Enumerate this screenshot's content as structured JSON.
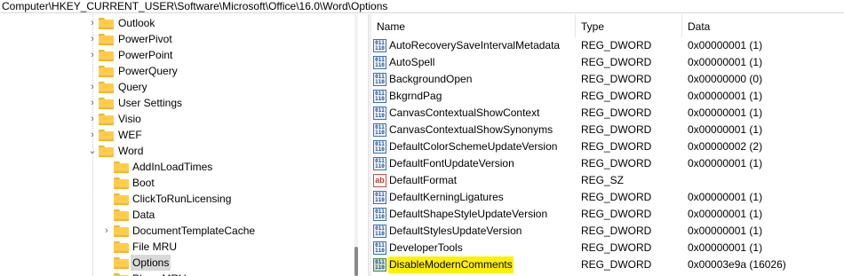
{
  "address": "Computer\\HKEY_CURRENT_USER\\Software\\Microsoft\\Office\\16.0\\Word\\Options",
  "tree": {
    "items": [
      {
        "label": "Outlook",
        "expander": "›"
      },
      {
        "label": "PowerPivot",
        "expander": "›"
      },
      {
        "label": "PowerPoint",
        "expander": "›"
      },
      {
        "label": "PowerQuery",
        "expander": ""
      },
      {
        "label": "Query",
        "expander": "›"
      },
      {
        "label": "User Settings",
        "expander": "›"
      },
      {
        "label": "Visio",
        "expander": "›"
      },
      {
        "label": "WEF",
        "expander": "›"
      },
      {
        "label": "Word",
        "expander": "⌄"
      },
      {
        "label": "AddInLoadTimes",
        "expander": ""
      },
      {
        "label": "Boot",
        "expander": ""
      },
      {
        "label": "ClickToRunLicensing",
        "expander": ""
      },
      {
        "label": "Data",
        "expander": ""
      },
      {
        "label": "DocumentTemplateCache",
        "expander": "›"
      },
      {
        "label": "File MRU",
        "expander": ""
      },
      {
        "label": "Options",
        "expander": "",
        "selected": true
      },
      {
        "label": "Place MRU",
        "expander": ""
      }
    ]
  },
  "columns": {
    "name": "Name",
    "type": "Type",
    "data": "Data"
  },
  "values": [
    {
      "icon": "binary-value-icon",
      "name": "AutoRecoverySaveIntervalMetadata",
      "type": "REG_DWORD",
      "data": "0x00000001 (1)"
    },
    {
      "icon": "binary-value-icon",
      "name": "AutoSpell",
      "type": "REG_DWORD",
      "data": "0x00000001 (1)"
    },
    {
      "icon": "binary-value-icon",
      "name": "BackgroundOpen",
      "type": "REG_DWORD",
      "data": "0x00000000 (0)"
    },
    {
      "icon": "binary-value-icon",
      "name": "BkgrndPag",
      "type": "REG_DWORD",
      "data": "0x00000001 (1)"
    },
    {
      "icon": "binary-value-icon",
      "name": "CanvasContextualShowContext",
      "type": "REG_DWORD",
      "data": "0x00000001 (1)"
    },
    {
      "icon": "binary-value-icon",
      "name": "CanvasContextualShowSynonyms",
      "type": "REG_DWORD",
      "data": "0x00000001 (1)"
    },
    {
      "icon": "binary-value-icon",
      "name": "DefaultColorSchemeUpdateVersion",
      "type": "REG_DWORD",
      "data": "0x00000002 (2)"
    },
    {
      "icon": "binary-value-icon",
      "name": "DefaultFontUpdateVersion",
      "type": "REG_DWORD",
      "data": "0x00000001 (1)"
    },
    {
      "icon": "string-value-icon",
      "name": "DefaultFormat",
      "type": "REG_SZ",
      "data": ""
    },
    {
      "icon": "binary-value-icon",
      "name": "DefaultKerningLigatures",
      "type": "REG_DWORD",
      "data": "0x00000001 (1)"
    },
    {
      "icon": "binary-value-icon",
      "name": "DefaultShapeStyleUpdateVersion",
      "type": "REG_DWORD",
      "data": "0x00000001 (1)"
    },
    {
      "icon": "binary-value-icon",
      "name": "DefaultStylesUpdateVersion",
      "type": "REG_DWORD",
      "data": "0x00000001 (1)"
    },
    {
      "icon": "binary-value-icon",
      "name": "DeveloperTools",
      "type": "REG_DWORD",
      "data": "0x00000001 (1)"
    },
    {
      "icon": "binary-value-icon",
      "name": "DisableModernComments",
      "type": "REG_DWORD",
      "data": "0x00003e9a (16026)",
      "highlighted": true
    }
  ],
  "colors": {
    "highlight": "#fff000",
    "folder": "#ffcc4d",
    "selection": "#d9d9d9"
  }
}
